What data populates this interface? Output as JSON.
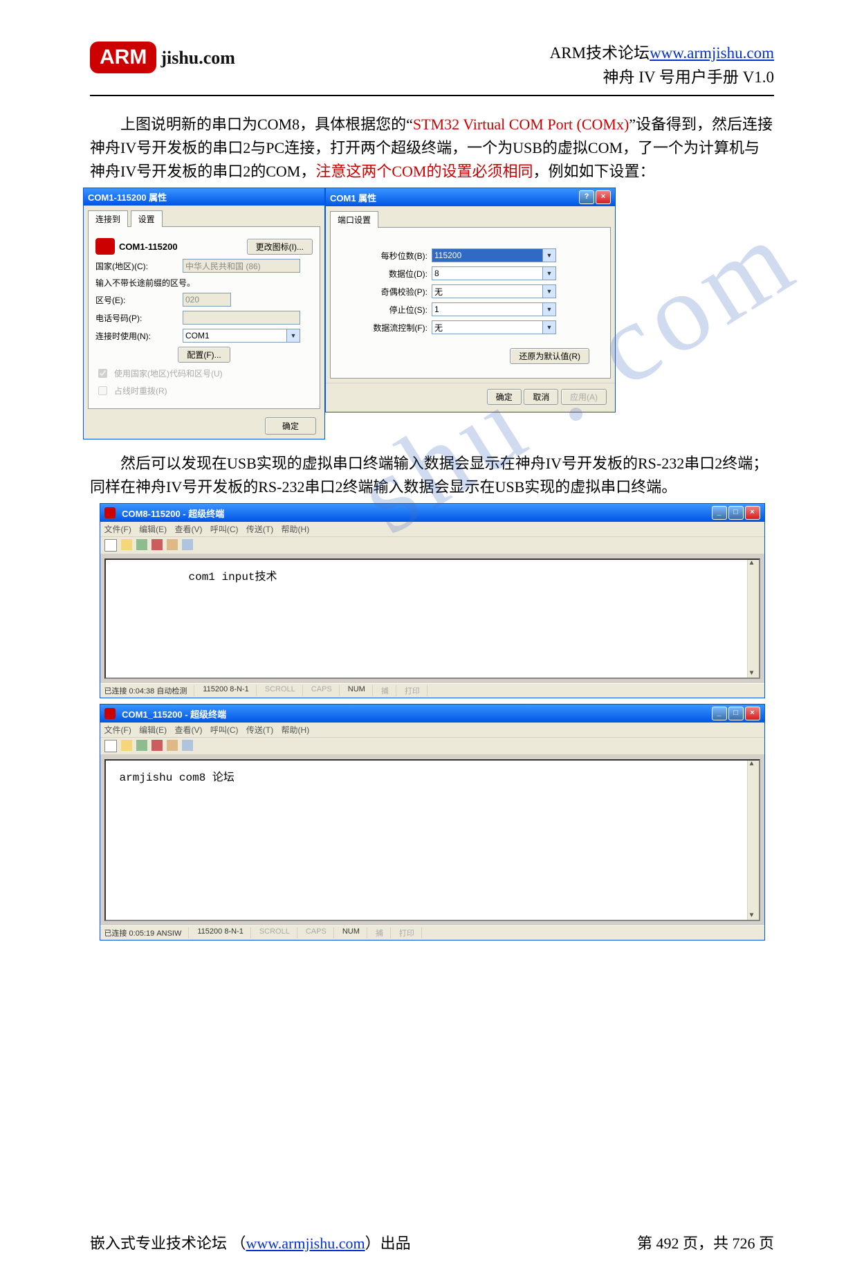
{
  "header": {
    "logo_text": "ARM",
    "logo_tail": "jishu.com",
    "forum_label": "ARM技术论坛",
    "forum_url": "www.armjishu.com",
    "manual_title": "神舟 IV 号用户手册  V1.0"
  },
  "para1": {
    "seg1": "上图说明新的串口为COM8，具体根据您的“",
    "seg2_red": "STM32 Virtual COM Port (COMx)",
    "seg3": "”设备得到，然后连接神舟IV号开发板的串口2与PC连接，打开两个超级终端，一个为USB的虚拟COM，了一个为计算机与神舟IV号开发板的串口2的COM，",
    "seg4_red": "注意这两个COM的设置必须相同",
    "seg5": "，例如如下设置："
  },
  "dlg1": {
    "title": "COM1-115200 属性",
    "tabs": [
      "连接到",
      "设置"
    ],
    "conn_name": "COM1-115200",
    "change_icon_btn": "更改图标(I)...",
    "country_label": "国家(地区)(C):",
    "country_value": "中华人民共和国 (86)",
    "hint": "输入不带长途前缀的区号。",
    "areacode_label": "区号(E):",
    "areacode_value": "020",
    "phone_label": "电话号码(P):",
    "phone_value": "",
    "connect_using_label": "连接时使用(N):",
    "connect_using_value": "COM1",
    "config_btn": "配置(F)...",
    "chk1": "使用国家(地区)代码和区号(U)",
    "chk2": "占线时重拨(R)",
    "ok_btn": "确定"
  },
  "dlg2": {
    "title": "COM1 属性",
    "tab": "端口设置",
    "fields": {
      "baud_label": "每秒位数(B):",
      "baud_value": "115200",
      "databits_label": "数据位(D):",
      "databits_value": "8",
      "parity_label": "奇偶校验(P):",
      "parity_value": "无",
      "stopbits_label": "停止位(S):",
      "stopbits_value": "1",
      "flow_label": "数据流控制(F):",
      "flow_value": "无"
    },
    "restore_btn": "还原为默认值(R)",
    "ok_btn": "确定",
    "cancel_btn": "取消",
    "apply_btn": "应用(A)"
  },
  "para2": "然后可以发现在USB实现的虚拟串口终端输入数据会显示在神舟IV号开发板的RS-232串口2终端；同样在神舟IV号开发板的RS-232串口2终端输入数据会显示在USB实现的虚拟串口终端。",
  "term1": {
    "title": "COM8-115200 - 超级终端",
    "menus": [
      "文件(F)",
      "编辑(E)",
      "查看(V)",
      "呼叫(C)",
      "传送(T)",
      "帮助(H)"
    ],
    "content": "com1 input技术",
    "status": {
      "conn": "已连接 0:04:38 自动检测",
      "params": "115200 8-N-1",
      "scroll": "SCROLL",
      "caps": "CAPS",
      "num": "NUM",
      "capture": "捕",
      "print": "打印"
    }
  },
  "term2": {
    "title": "COM1_115200 - 超级终端",
    "menus": [
      "文件(F)",
      "编辑(E)",
      "查看(V)",
      "呼叫(C)",
      "传送(T)",
      "帮助(H)"
    ],
    "content": "armjishu com8 论坛",
    "status": {
      "conn": "已连接 0:05:19 ANSIW",
      "params": "115200 8-N-1",
      "scroll": "SCROLL",
      "caps": "CAPS",
      "num": "NUM",
      "capture": "捕",
      "print": "打印"
    }
  },
  "footer": {
    "left_pre": "嵌入式专业技术论坛 （",
    "left_link": "www.armjishu.com",
    "left_post": "）出品",
    "right": "第 492 页，共 726 页"
  },
  "watermark": "shu . com"
}
